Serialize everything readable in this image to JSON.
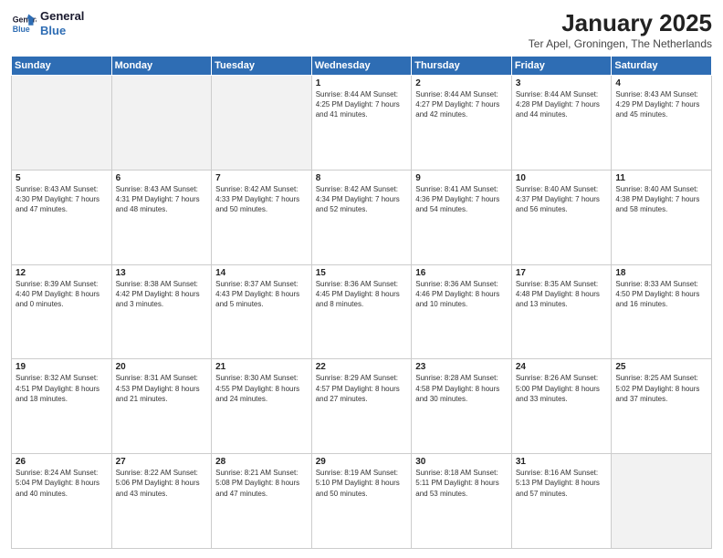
{
  "logo": {
    "line1": "General",
    "line2": "Blue"
  },
  "title": "January 2025",
  "subtitle": "Ter Apel, Groningen, The Netherlands",
  "days_of_week": [
    "Sunday",
    "Monday",
    "Tuesday",
    "Wednesday",
    "Thursday",
    "Friday",
    "Saturday"
  ],
  "weeks": [
    [
      {
        "day": "",
        "text": ""
      },
      {
        "day": "",
        "text": ""
      },
      {
        "day": "",
        "text": ""
      },
      {
        "day": "1",
        "text": "Sunrise: 8:44 AM\nSunset: 4:25 PM\nDaylight: 7 hours\nand 41 minutes."
      },
      {
        "day": "2",
        "text": "Sunrise: 8:44 AM\nSunset: 4:27 PM\nDaylight: 7 hours\nand 42 minutes."
      },
      {
        "day": "3",
        "text": "Sunrise: 8:44 AM\nSunset: 4:28 PM\nDaylight: 7 hours\nand 44 minutes."
      },
      {
        "day": "4",
        "text": "Sunrise: 8:43 AM\nSunset: 4:29 PM\nDaylight: 7 hours\nand 45 minutes."
      }
    ],
    [
      {
        "day": "5",
        "text": "Sunrise: 8:43 AM\nSunset: 4:30 PM\nDaylight: 7 hours\nand 47 minutes."
      },
      {
        "day": "6",
        "text": "Sunrise: 8:43 AM\nSunset: 4:31 PM\nDaylight: 7 hours\nand 48 minutes."
      },
      {
        "day": "7",
        "text": "Sunrise: 8:42 AM\nSunset: 4:33 PM\nDaylight: 7 hours\nand 50 minutes."
      },
      {
        "day": "8",
        "text": "Sunrise: 8:42 AM\nSunset: 4:34 PM\nDaylight: 7 hours\nand 52 minutes."
      },
      {
        "day": "9",
        "text": "Sunrise: 8:41 AM\nSunset: 4:36 PM\nDaylight: 7 hours\nand 54 minutes."
      },
      {
        "day": "10",
        "text": "Sunrise: 8:40 AM\nSunset: 4:37 PM\nDaylight: 7 hours\nand 56 minutes."
      },
      {
        "day": "11",
        "text": "Sunrise: 8:40 AM\nSunset: 4:38 PM\nDaylight: 7 hours\nand 58 minutes."
      }
    ],
    [
      {
        "day": "12",
        "text": "Sunrise: 8:39 AM\nSunset: 4:40 PM\nDaylight: 8 hours\nand 0 minutes."
      },
      {
        "day": "13",
        "text": "Sunrise: 8:38 AM\nSunset: 4:42 PM\nDaylight: 8 hours\nand 3 minutes."
      },
      {
        "day": "14",
        "text": "Sunrise: 8:37 AM\nSunset: 4:43 PM\nDaylight: 8 hours\nand 5 minutes."
      },
      {
        "day": "15",
        "text": "Sunrise: 8:36 AM\nSunset: 4:45 PM\nDaylight: 8 hours\nand 8 minutes."
      },
      {
        "day": "16",
        "text": "Sunrise: 8:36 AM\nSunset: 4:46 PM\nDaylight: 8 hours\nand 10 minutes."
      },
      {
        "day": "17",
        "text": "Sunrise: 8:35 AM\nSunset: 4:48 PM\nDaylight: 8 hours\nand 13 minutes."
      },
      {
        "day": "18",
        "text": "Sunrise: 8:33 AM\nSunset: 4:50 PM\nDaylight: 8 hours\nand 16 minutes."
      }
    ],
    [
      {
        "day": "19",
        "text": "Sunrise: 8:32 AM\nSunset: 4:51 PM\nDaylight: 8 hours\nand 18 minutes."
      },
      {
        "day": "20",
        "text": "Sunrise: 8:31 AM\nSunset: 4:53 PM\nDaylight: 8 hours\nand 21 minutes."
      },
      {
        "day": "21",
        "text": "Sunrise: 8:30 AM\nSunset: 4:55 PM\nDaylight: 8 hours\nand 24 minutes."
      },
      {
        "day": "22",
        "text": "Sunrise: 8:29 AM\nSunset: 4:57 PM\nDaylight: 8 hours\nand 27 minutes."
      },
      {
        "day": "23",
        "text": "Sunrise: 8:28 AM\nSunset: 4:58 PM\nDaylight: 8 hours\nand 30 minutes."
      },
      {
        "day": "24",
        "text": "Sunrise: 8:26 AM\nSunset: 5:00 PM\nDaylight: 8 hours\nand 33 minutes."
      },
      {
        "day": "25",
        "text": "Sunrise: 8:25 AM\nSunset: 5:02 PM\nDaylight: 8 hours\nand 37 minutes."
      }
    ],
    [
      {
        "day": "26",
        "text": "Sunrise: 8:24 AM\nSunset: 5:04 PM\nDaylight: 8 hours\nand 40 minutes."
      },
      {
        "day": "27",
        "text": "Sunrise: 8:22 AM\nSunset: 5:06 PM\nDaylight: 8 hours\nand 43 minutes."
      },
      {
        "day": "28",
        "text": "Sunrise: 8:21 AM\nSunset: 5:08 PM\nDaylight: 8 hours\nand 47 minutes."
      },
      {
        "day": "29",
        "text": "Sunrise: 8:19 AM\nSunset: 5:10 PM\nDaylight: 8 hours\nand 50 minutes."
      },
      {
        "day": "30",
        "text": "Sunrise: 8:18 AM\nSunset: 5:11 PM\nDaylight: 8 hours\nand 53 minutes."
      },
      {
        "day": "31",
        "text": "Sunrise: 8:16 AM\nSunset: 5:13 PM\nDaylight: 8 hours\nand 57 minutes."
      },
      {
        "day": "",
        "text": ""
      }
    ]
  ]
}
